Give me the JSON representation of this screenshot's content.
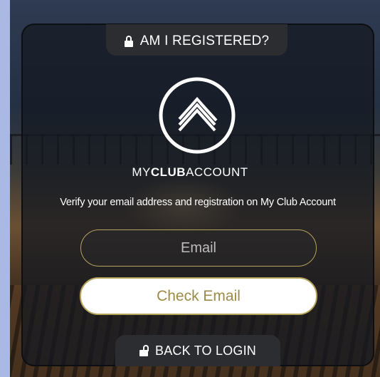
{
  "header_tab": {
    "label": "AM I REGISTERED?",
    "icon": "lock-icon"
  },
  "brand": {
    "part1": "MY",
    "part2": "CLUB",
    "part3": "ACCOUNT",
    "logo_icon": "chevron-stack-logo-icon"
  },
  "description": "Verify your email address and registration on My Club Account",
  "email_field": {
    "placeholder": "Email",
    "value": ""
  },
  "check_button": {
    "label": "Check Email"
  },
  "footer_tab": {
    "label": "BACK TO LOGIN",
    "icon": "unlock-icon"
  },
  "colors": {
    "accent_gold": "#b5a45c",
    "button_text": "#9c8a46",
    "panel_bg": "#14182180",
    "page_bg": "#a9b9e3"
  }
}
